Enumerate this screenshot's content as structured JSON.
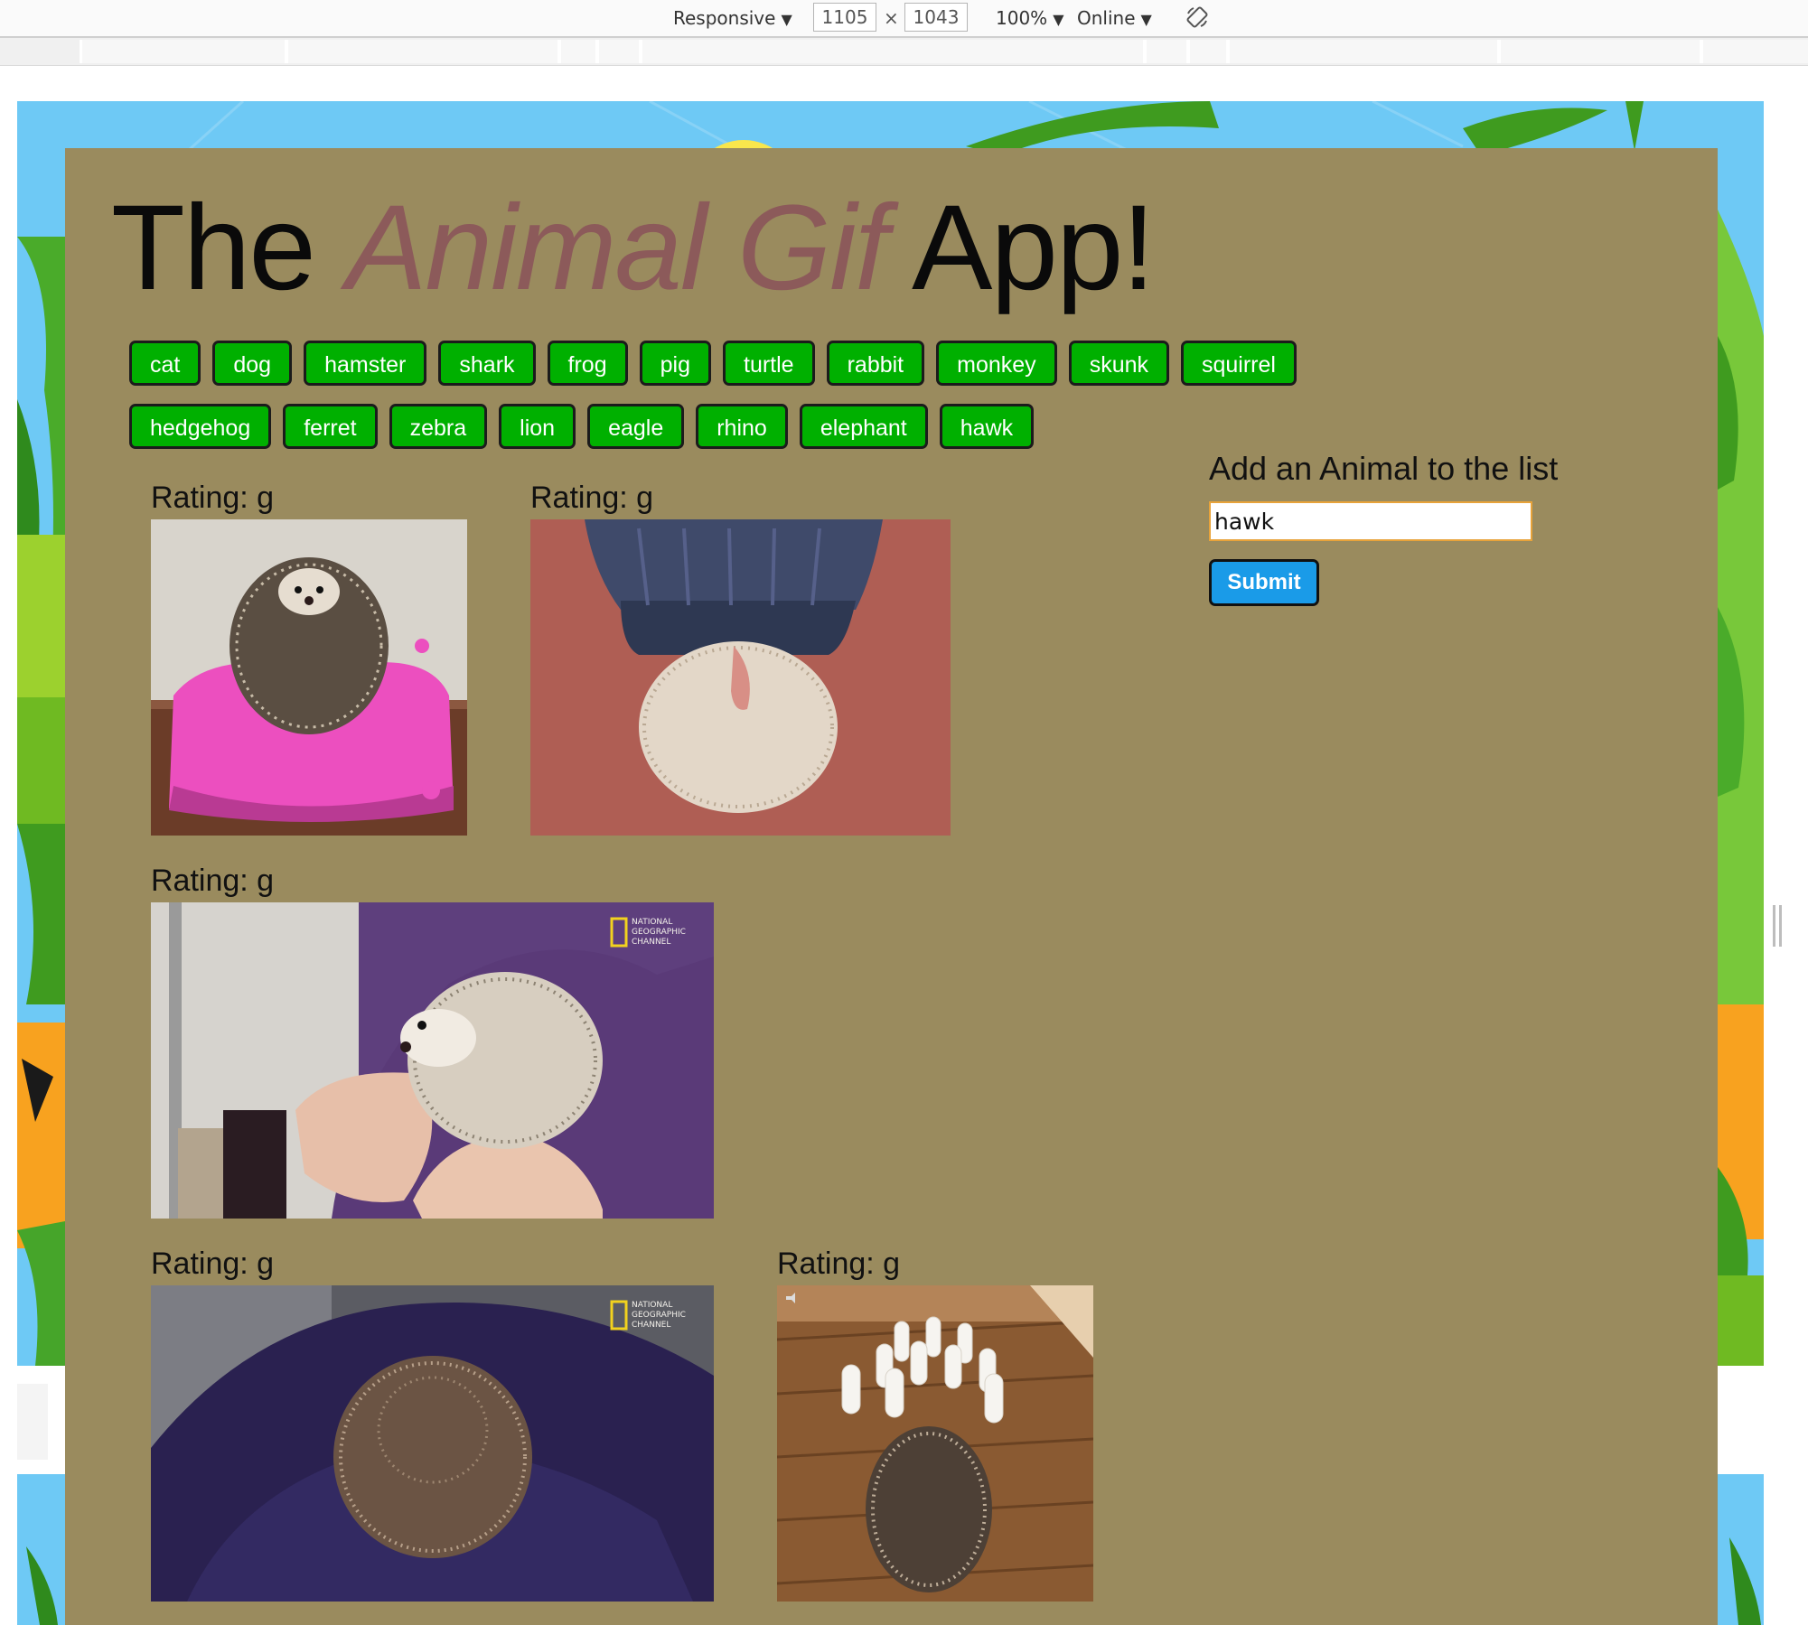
{
  "devtools": {
    "device_mode": "Responsive",
    "width": "1105",
    "times_sign": "×",
    "height": "1043",
    "zoom": "100%",
    "network": "Online",
    "caret": "▼",
    "rotate_icon": "rotate-icon"
  },
  "page": {
    "title_part1": "The ",
    "title_accent": "Animal Gif",
    "title_part2": " App!",
    "colors": {
      "panel": "#9a8b5e",
      "title_accent": "#8c5a5a",
      "animal_button": "#00b000",
      "submit_button": "#1a9be8",
      "sky": "#6ec9f5"
    }
  },
  "animal_buttons": [
    "cat",
    "dog",
    "hamster",
    "shark",
    "frog",
    "pig",
    "turtle",
    "rabbit",
    "monkey",
    "skunk",
    "squirrel",
    "hedgehog",
    "ferret",
    "zebra",
    "lion",
    "eagle",
    "rhino",
    "elephant",
    "hawk"
  ],
  "add_form": {
    "label": "Add an Animal to the list",
    "input_value": "hawk",
    "submit_label": "Submit"
  },
  "gifs": [
    {
      "rating": "Rating: g"
    },
    {
      "rating": "Rating: g"
    },
    {
      "rating": "Rating: g",
      "watermark": "NATIONAL GEOGRAPHIC CHANNEL"
    },
    {
      "rating": "Rating: g",
      "watermark": "NATIONAL GEOGRAPHIC CHANNEL"
    },
    {
      "rating": "Rating: g"
    }
  ]
}
